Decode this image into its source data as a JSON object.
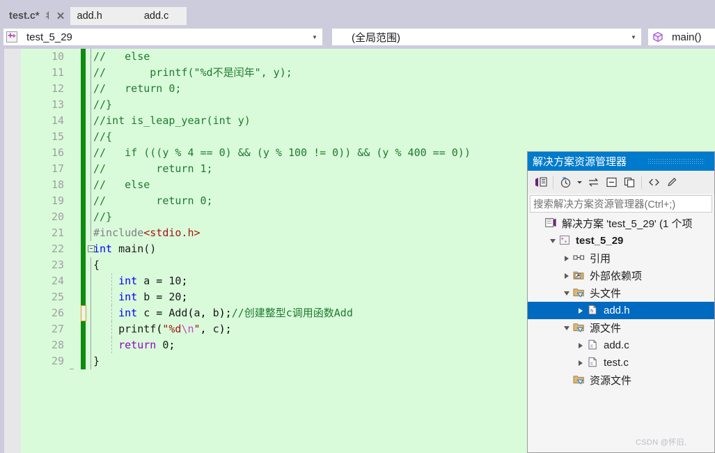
{
  "window": {
    "app": "Visual Studio",
    "watermark": "CSDN @怀旧,"
  },
  "tabs": [
    {
      "label": "test.c*",
      "active": true,
      "dirty": true,
      "pin_icon": "pin-icon",
      "close_icon": "close-icon"
    },
    {
      "label": "add.h",
      "active": false
    },
    {
      "label": "add.c",
      "active": false
    }
  ],
  "navbar": {
    "project": {
      "value": "test_5_29",
      "icon": "project-icon",
      "dropdown_icon": "chevron-down-icon"
    },
    "scope": {
      "value": "(全局范围)",
      "dropdown_icon": "chevron-down-icon"
    },
    "member": {
      "value": "main()",
      "icon": "method-cube-icon",
      "dropdown_icon": "chevron-down-icon"
    }
  },
  "editor": {
    "language": "C",
    "current_line": 22,
    "lines": [
      {
        "n": "10",
        "change": "saved",
        "text_html": "<span class='c-cmt'>//   else</span>"
      },
      {
        "n": "11",
        "change": "saved",
        "text_html": "<span class='c-cmt'>//       printf(\"%d不是闰年\", y);</span>"
      },
      {
        "n": "12",
        "change": "saved",
        "text_html": "<span class='c-cmt'>//   return 0;</span>"
      },
      {
        "n": "13",
        "change": "saved",
        "text_html": "<span class='c-cmt'>//}</span>"
      },
      {
        "n": "14",
        "change": "saved",
        "text_html": "<span class='c-cmt'>//int is_leap_year(int y)</span>"
      },
      {
        "n": "15",
        "change": "saved",
        "text_html": "<span class='c-cmt'>//{</span>"
      },
      {
        "n": "16",
        "change": "saved",
        "text_html": "<span class='c-cmt'>//   if (((y % 4 == 0) &amp;&amp; (y % 100 != 0)) &amp;&amp; (y % 400 == 0))</span>"
      },
      {
        "n": "17",
        "change": "saved",
        "text_html": "<span class='c-cmt'>//        return 1;</span>"
      },
      {
        "n": "18",
        "change": "saved",
        "text_html": "<span class='c-cmt'>//   else</span>"
      },
      {
        "n": "19",
        "change": "saved",
        "text_html": "<span class='c-cmt'>//        return 0;</span>"
      },
      {
        "n": "20",
        "change": "saved",
        "text_html": "<span class='c-cmt'>//}</span>"
      },
      {
        "n": "21",
        "change": "saved",
        "text_html": "<span class='c-pp'>#include</span><span class='c-inc'>&lt;stdio.h&gt;</span>"
      },
      {
        "n": "22",
        "change": "saved",
        "text_html": "<span class='c-kw'>int</span> <span class='c-fn'>main</span><span class='c-id'>()</span>"
      },
      {
        "n": "23",
        "change": "saved",
        "text_html": "<span class='c-id'>{</span>"
      },
      {
        "n": "24",
        "change": "saved",
        "text_html": "    <span class='c-kw'>int</span> <span class='c-id'>a</span> = <span class='c-num'>10</span>;"
      },
      {
        "n": "25",
        "change": "saved",
        "text_html": "    <span class='c-kw'>int</span> <span class='c-id'>b</span> = <span class='c-num'>20</span>;"
      },
      {
        "n": "26",
        "change": "unsaved",
        "text_html": "    <span class='c-kw'>int</span> <span class='c-id'>c</span> = <span class='c-fn'>Add</span>(<span class='c-id'>a</span>, <span class='c-id'>b</span>);<span class='c-cmt'>//创建整型c调用函数Add</span>"
      },
      {
        "n": "27",
        "change": "saved",
        "text_html": "    <span class='c-fn'>printf</span>(<span class='c-str'>\"%d</span><span class='c-esc'>\\n</span><span class='c-str'>\"</span>, <span class='c-id'>c</span>);"
      },
      {
        "n": "28",
        "change": "saved",
        "text_html": "    <span class='c-ctl'>return</span> <span class='c-num'>0</span>;"
      },
      {
        "n": "29",
        "change": "saved",
        "text_html": "<span class='c-id'>}</span>"
      }
    ]
  },
  "solution_explorer": {
    "title": "解决方案资源管理器",
    "toolbar": [
      {
        "name": "home-vs-icon",
        "glyph": "⊠"
      },
      {
        "name": "pending-changes-filter-icon",
        "glyph": "◷"
      },
      {
        "name": "filter-dropdown-icon",
        "glyph": "▾"
      },
      {
        "name": "sync-with-active-document-icon",
        "glyph": "⇆"
      },
      {
        "name": "collapse-all-icon",
        "glyph": "⊟"
      },
      {
        "name": "show-all-files-icon",
        "glyph": "❐"
      },
      {
        "name": "view-code-icon",
        "glyph": "<>"
      },
      {
        "name": "properties-icon",
        "glyph": "🖉"
      }
    ],
    "search_placeholder": "搜索解决方案资源管理器(Ctrl+;)",
    "tree": [
      {
        "label": "解决方案 'test_5_29' (1 个项",
        "icon": "solution-icon",
        "indent": 0,
        "twisty": "none",
        "bold": false,
        "selected": false
      },
      {
        "label": "test_5_29",
        "icon": "project-icon",
        "indent": 1,
        "twisty": "down",
        "bold": true,
        "selected": false
      },
      {
        "label": "引用",
        "icon": "references-icon",
        "indent": 2,
        "twisty": "right",
        "bold": false,
        "selected": false
      },
      {
        "label": "外部依赖项",
        "icon": "external-deps-icon",
        "indent": 2,
        "twisty": "right",
        "bold": false,
        "selected": false
      },
      {
        "label": "头文件",
        "icon": "filter-folder-icon",
        "indent": 2,
        "twisty": "down",
        "bold": false,
        "selected": false
      },
      {
        "label": "add.h",
        "icon": "h-file-icon",
        "indent": 3,
        "twisty": "right",
        "bold": false,
        "selected": true
      },
      {
        "label": "源文件",
        "icon": "filter-folder-icon",
        "indent": 2,
        "twisty": "down",
        "bold": false,
        "selected": false
      },
      {
        "label": "add.c",
        "icon": "c-file-icon",
        "indent": 3,
        "twisty": "right",
        "bold": false,
        "selected": false
      },
      {
        "label": "test.c",
        "icon": "c-file-icon",
        "indent": 3,
        "twisty": "right",
        "bold": false,
        "selected": false
      },
      {
        "label": "资源文件",
        "icon": "filter-folder-icon",
        "indent": 2,
        "twisty": "none",
        "bold": false,
        "selected": false
      }
    ]
  },
  "colors": {
    "accent": "#007acc",
    "selection": "#0069c0",
    "editor_background": "#d9fbda",
    "change_bar_saved": "#108a10",
    "change_bar_unsaved": "#d6a41b",
    "comment": "#1f7a2f",
    "keyword": "#0000ff",
    "string": "#a31515"
  }
}
